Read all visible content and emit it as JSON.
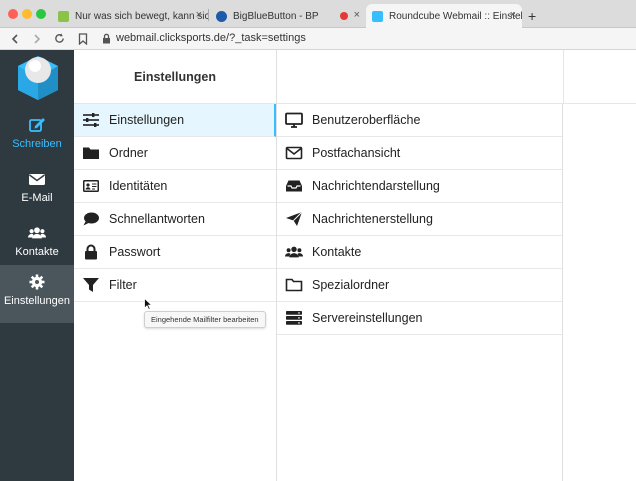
{
  "browser": {
    "tabs": [
      {
        "label": "Nur was sich bewegt, kann sich",
        "active": false
      },
      {
        "label": "BigBlueButton - BP",
        "active": false
      },
      {
        "label": "Roundcube Webmail :: Einstellun",
        "active": true
      }
    ],
    "close_glyph": "×",
    "newtab_glyph": "+",
    "url": "webmail.clicksports.de/?_task=settings",
    "colors": {
      "red": "#ff5f57",
      "yellow": "#febc2e",
      "green": "#28c840"
    }
  },
  "nav": {
    "items": [
      {
        "label": "Schreiben",
        "icon": "compose-icon"
      },
      {
        "label": "E-Mail",
        "icon": "envelope-icon"
      },
      {
        "label": "Kontakte",
        "icon": "users-icon"
      },
      {
        "label": "Einstellungen",
        "icon": "gear-icon"
      }
    ],
    "accent": "#37beff"
  },
  "settings": {
    "header": "Einstellungen",
    "items": [
      {
        "label": "Einstellungen",
        "icon": "sliders-icon"
      },
      {
        "label": "Ordner",
        "icon": "folder-icon"
      },
      {
        "label": "Identitäten",
        "icon": "id-card-icon"
      },
      {
        "label": "Schnellantworten",
        "icon": "comment-icon"
      },
      {
        "label": "Passwort",
        "icon": "lock-icon"
      },
      {
        "label": "Filter",
        "icon": "filter-icon"
      }
    ],
    "tooltip": "Eingehende Mailfilter bearbeiten"
  },
  "sections": {
    "items": [
      {
        "label": "Benutzeroberfläche",
        "icon": "monitor-icon"
      },
      {
        "label": "Postfachansicht",
        "icon": "envelope-outline-icon"
      },
      {
        "label": "Nachrichtendarstellung",
        "icon": "inbox-icon"
      },
      {
        "label": "Nachrichtenerstellung",
        "icon": "paper-plane-icon"
      },
      {
        "label": "Kontakte",
        "icon": "users-icon"
      },
      {
        "label": "Spezialordner",
        "icon": "folder-outline-icon"
      },
      {
        "label": "Servereinstellungen",
        "icon": "server-icon"
      }
    ]
  }
}
